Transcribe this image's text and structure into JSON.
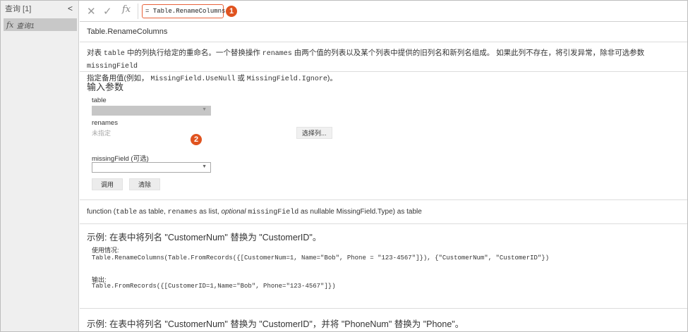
{
  "query_pane": {
    "header": "查询 [1]",
    "collapse": "<",
    "items": [
      {
        "fx": "fx",
        "label": "查询1"
      }
    ]
  },
  "formula_bar": {
    "cancel": "✕",
    "commit": "✓",
    "fx": "fx",
    "formula": "= Table.RenameColumns",
    "callout_1": "1"
  },
  "function": {
    "title": "Table.RenameColumns",
    "desc_line1_parts": [
      "对表 ",
      "table",
      " 中的列执行给定的重命名。一个替换操作 ",
      "renames",
      " 由两个值的列表以及某个列表中提供的旧列名和新列名组成。 如果此列不存在，将引发异常，除非可选参数 ",
      "missingField"
    ],
    "desc_line2_parts": [
      "指定备用值(例如， ",
      "MissingField.UseNull",
      " 或 ",
      "MissingField.Ignore",
      ")。"
    ]
  },
  "params": {
    "heading": "输入参数",
    "table_label": "table",
    "renames_label": "renames",
    "renames_value": "未指定",
    "select_columns": "选择列...",
    "missing_label": "missingField (可选)",
    "invoke": "调用",
    "clear": "清除",
    "callout_2": "2"
  },
  "signature_parts": [
    "function (",
    "table",
    " as table, ",
    "renames",
    " as list, ",
    "optional",
    " ",
    "missingField",
    " as nullable MissingField.Type) as table"
  ],
  "examples": [
    {
      "title": "示例: 在表中将列名 \"CustomerNum\" 替换为 \"CustomerID\"。",
      "usage_label": "使用情况:",
      "usage_code": "Table.RenameColumns(Table.FromRecords({[CustomerNum=1, Name=\"Bob\", Phone = \"123-4567\"]}), {\"CustomerNum\", \"CustomerID\"})",
      "output_label": "输出:",
      "output_code": "Table.FromRecords({[CustomerID=1,Name=\"Bob\", Phone=\"123-4567\"]})"
    },
    {
      "title": "示例: 在表中将列名 \"CustomerNum\" 替换为 \"CustomerID\"，并将 \"PhoneNum\" 替换为 \"Phone\"。"
    }
  ]
}
